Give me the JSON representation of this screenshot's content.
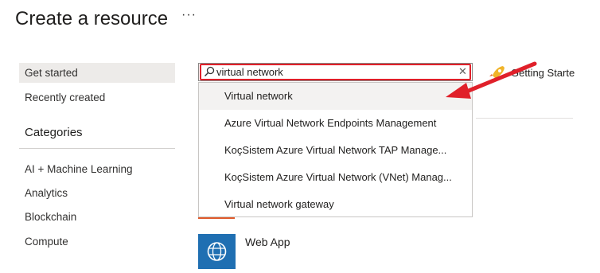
{
  "header": {
    "title": "Create a resource",
    "more_label": "···"
  },
  "sidebar": {
    "items": [
      {
        "label": "Get started",
        "selected": true
      },
      {
        "label": "Recently created",
        "selected": false
      }
    ],
    "categories_heading": "Categories",
    "categories": [
      "AI + Machine Learning",
      "Analytics",
      "Blockchain",
      "Compute"
    ]
  },
  "search": {
    "value": "virtual network",
    "placeholder": ""
  },
  "dropdown": {
    "items": [
      "Virtual network",
      "Azure Virtual Network Endpoints Management",
      "KoçSistem Azure Virtual Network TAP Manage...",
      "KoçSistem Azure Virtual Network (VNet) Manag...",
      "Virtual network gateway"
    ],
    "hovered_index": 0
  },
  "getting_started": {
    "label": "Getting Starte"
  },
  "resources": [
    {
      "label": "Web App",
      "icon": "web-app-icon"
    }
  ],
  "colors": {
    "highlight": "#e0202a",
    "accent": "#1f6fb2",
    "hover": "#f3f2f1",
    "selected": "#edebe9"
  }
}
